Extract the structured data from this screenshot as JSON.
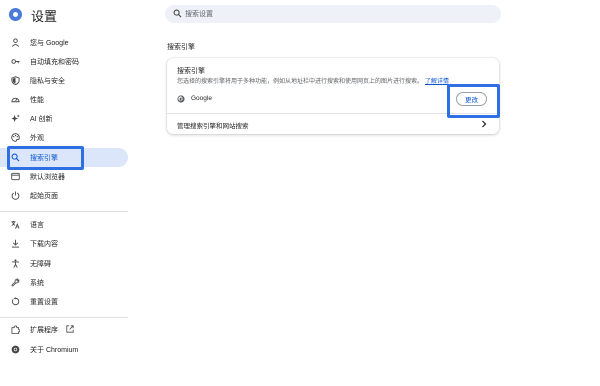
{
  "app": {
    "title": "设置"
  },
  "search": {
    "placeholder": "搜索设置"
  },
  "sidebar": {
    "items": [
      {
        "label": "您与 Google",
        "icon": "person-icon"
      },
      {
        "label": "自动填充和密码",
        "icon": "key-icon"
      },
      {
        "label": "隐私与安全",
        "icon": "shield-icon"
      },
      {
        "label": "性能",
        "icon": "speedometer-icon"
      },
      {
        "label": "AI 创新",
        "icon": "sparkle-icon"
      },
      {
        "label": "外观",
        "icon": "palette-icon"
      },
      {
        "label": "搜索引擎",
        "icon": "search-icon",
        "active": true
      },
      {
        "label": "默认浏览器",
        "icon": "browser-icon"
      },
      {
        "label": "起始页面",
        "icon": "power-icon"
      },
      {
        "label": "语言",
        "icon": "translate-icon"
      },
      {
        "label": "下载内容",
        "icon": "download-icon"
      },
      {
        "label": "无障碍",
        "icon": "accessibility-icon"
      },
      {
        "label": "系统",
        "icon": "wrench-icon"
      },
      {
        "label": "重置设置",
        "icon": "reset-icon"
      },
      {
        "label": "扩展程序",
        "icon": "puzzle-icon",
        "external": "open-in-new-icon"
      },
      {
        "label": "关于 Chromium",
        "icon": "chromium-icon"
      }
    ]
  },
  "main": {
    "section_title": "搜索引擎",
    "card": {
      "heading": "搜索引擎",
      "description": "您选择的搜索引擎将用于多种功能，例如从地址栏中进行搜索和使用网页上的图片进行搜索。",
      "learn_more": "了解详情",
      "engine": {
        "name": "Google",
        "icon": "google-icon"
      },
      "change_button": "更改",
      "manage_label": "管理搜索引擎和网站搜索"
    }
  },
  "colors": {
    "accent": "#0b57d0",
    "highlight": "#2f6fe4",
    "active_bg": "#dbe6fa"
  }
}
